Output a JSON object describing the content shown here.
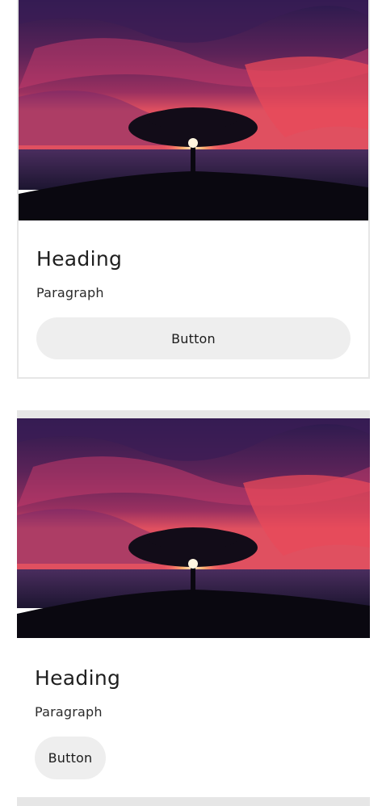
{
  "cards": [
    {
      "image": "sunset-tree-image",
      "heading": "Heading",
      "paragraph": "Paragraph",
      "button_label": "Button"
    },
    {
      "image": "sunset-tree-image",
      "heading": "Heading",
      "paragraph": "Paragraph",
      "button_label": "Button"
    }
  ],
  "colors": {
    "card_border": "#e6e6e6",
    "button_bg": "#eeeeee",
    "sky_dark": "#1a1540",
    "sky_glow": "#e2405a",
    "sun": "#ffd9a0"
  }
}
